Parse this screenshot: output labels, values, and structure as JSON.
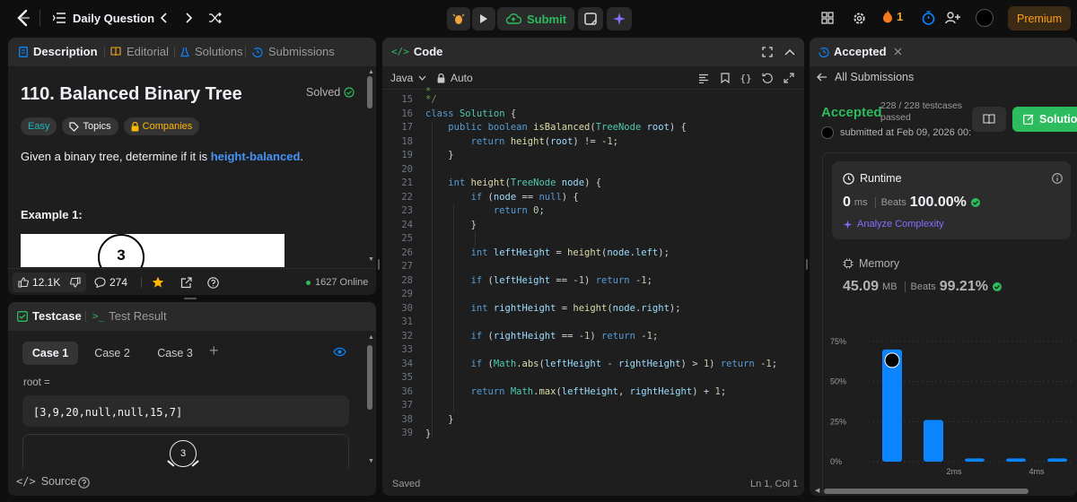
{
  "topbar": {
    "title": "Daily Question",
    "submit_label": "Submit",
    "streak_count": "1",
    "premium_label": "Premium"
  },
  "left": {
    "tabs": {
      "description": "Description",
      "editorial": "Editorial",
      "solutions": "Solutions",
      "submissions": "Submissions"
    },
    "problem_title": "110. Balanced Binary Tree",
    "solved_label": "Solved",
    "tags": {
      "difficulty": "Easy",
      "topics": "Topics",
      "companies": "Companies"
    },
    "desc_prefix": "Given a binary tree, determine if it is ",
    "desc_link": "height-balanced",
    "desc_suffix": ".",
    "example_heading": "Example 1:",
    "tree_root_value": "3",
    "footer": {
      "likes": "12.1K",
      "comments": "274",
      "online": "1627 Online"
    }
  },
  "testcase": {
    "tab_testcase": "Testcase",
    "tab_result": "Test Result",
    "cases": [
      "Case 1",
      "Case 2",
      "Case 3"
    ],
    "add_symbol": "+",
    "input_label": "root =",
    "input_value": "[3,9,20,null,null,15,7]",
    "tree_root_value": "3",
    "source_label": "Source"
  },
  "editor": {
    "title": "Code",
    "language": "Java",
    "mode": "Auto",
    "status_saved": "Saved",
    "cursor_position": "Ln 1, Col 1",
    "line_numbers": [
      "15",
      "16",
      "17",
      "18",
      "19",
      "20",
      "21",
      "22",
      "23",
      "24",
      "25",
      "26",
      "27",
      "28",
      "29",
      "30",
      "31",
      "32",
      "33",
      "34",
      "35",
      "36",
      "37",
      "38",
      "39"
    ]
  },
  "result": {
    "tab_title": "Accepted",
    "back_label": "All Submissions",
    "status": "Accepted",
    "testcases": "228 / 228 testcases",
    "testcases_suffix": "passed",
    "submitted": "submitted at Feb 09, 2026 00:",
    "solution_button": "Solutio",
    "runtime": {
      "label": "Runtime",
      "value": "0",
      "unit": "ms",
      "beats_label": "Beats",
      "beats_value": "100.00%",
      "analyze_label": "Analyze Complexity"
    },
    "memory": {
      "label": "Memory",
      "value": "45.09",
      "unit": "MB",
      "beats_label": "Beats",
      "beats_value": "99.21%"
    }
  },
  "chart_data": {
    "type": "bar",
    "ylim": [
      0,
      75
    ],
    "y_ticks": [
      "75%",
      "50%",
      "25%",
      "0%"
    ],
    "x_ticks": [
      "2ms",
      "4ms"
    ],
    "values": [
      70,
      26,
      2,
      2,
      2,
      2
    ],
    "highlight_index": 0,
    "bar_color": "#0a84ff"
  },
  "colors": {
    "accent_green": "#2cbb5d",
    "easy": "#1cb8b8",
    "medium": "#ffb800",
    "link": "#4493f8",
    "bar": "#0a84ff"
  }
}
